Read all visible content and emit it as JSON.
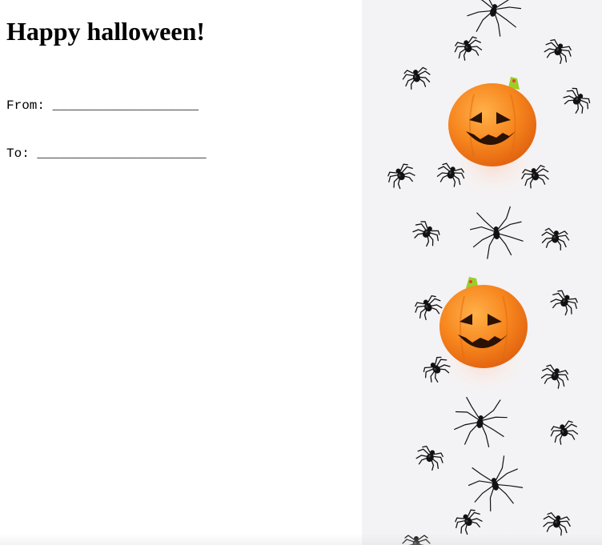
{
  "card": {
    "title": "Happy halloween!",
    "from_line": "From: ___________________",
    "to_line": "To: ______________________"
  },
  "decoration": {
    "image": "halloween-pumpkins-and-spiders-photo",
    "background_color": "#f3f2f4",
    "pumpkin_color": "#f7861e",
    "stem_color": "#9ccd2a",
    "spider_color": "#111111"
  }
}
